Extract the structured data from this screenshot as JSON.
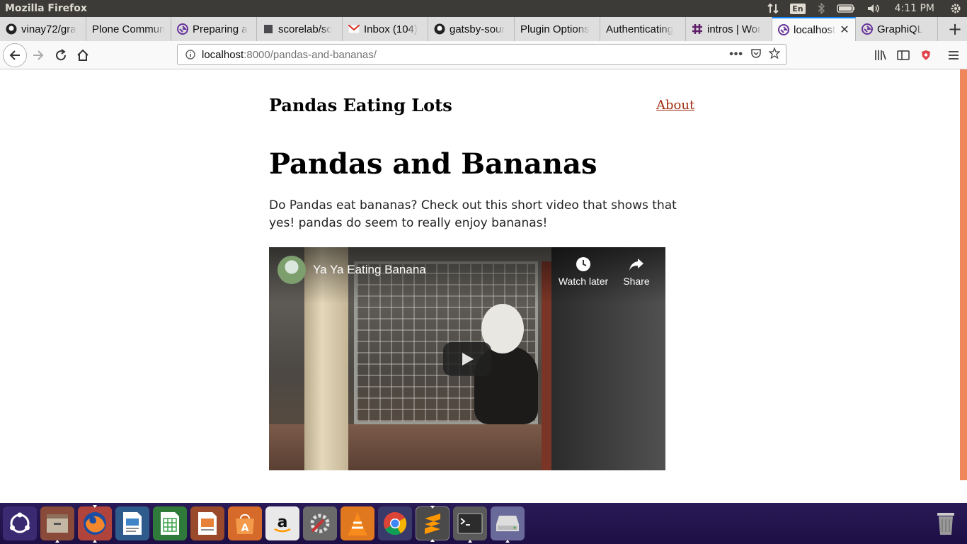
{
  "top_panel": {
    "app_name": "Mozilla Firefox",
    "language": "En",
    "clock": "4:11 PM"
  },
  "tabs": [
    {
      "label": "vinay72/gra",
      "icon": "github-icon"
    },
    {
      "label": "Plone Commun",
      "icon": "none"
    },
    {
      "label": "Preparing a",
      "icon": "gatsby-icon"
    },
    {
      "label": "scorelab/sc",
      "icon": "page-icon"
    },
    {
      "label": "Inbox (104)",
      "icon": "gmail-icon"
    },
    {
      "label": "gatsby-sour",
      "icon": "github-icon"
    },
    {
      "label": "Plugin Options",
      "icon": "none"
    },
    {
      "label": "Authenticating",
      "icon": "none"
    },
    {
      "label": "intros | Wor",
      "icon": "slack-icon"
    },
    {
      "label": "localhost",
      "icon": "gatsby-icon",
      "active": true
    },
    {
      "label": "GraphiQL",
      "icon": "gatsby-icon"
    }
  ],
  "url": {
    "host": "localhost",
    "rest": ":8000/pandas-and-bananas/"
  },
  "page": {
    "site_title": "Pandas Eating Lots",
    "nav_about": "About",
    "post_title": "Pandas and Bananas",
    "post_body": "Do Pandas eat bananas? Check out this short video that shows that yes! pandas do seem to really enjoy bananas!"
  },
  "video": {
    "title": "Ya Ya Eating Banana",
    "watch_later": "Watch later",
    "share": "Share"
  },
  "launcher": [
    "ubuntu-dash-icon",
    "files-icon",
    "firefox-icon",
    "writer-icon",
    "calc-icon",
    "impress-icon",
    "software-center-icon",
    "amazon-icon",
    "system-settings-icon",
    "vlc-icon",
    "chrome-icon",
    "sublime-text-icon",
    "terminal-icon",
    "drive-icon",
    "trash-icon"
  ],
  "colors": {
    "accent_link": "#9e2d11",
    "active_tab_border": "#0a84ff",
    "scroll_thumb": "#f0875c",
    "launcher_bg": "#2a1a57"
  }
}
